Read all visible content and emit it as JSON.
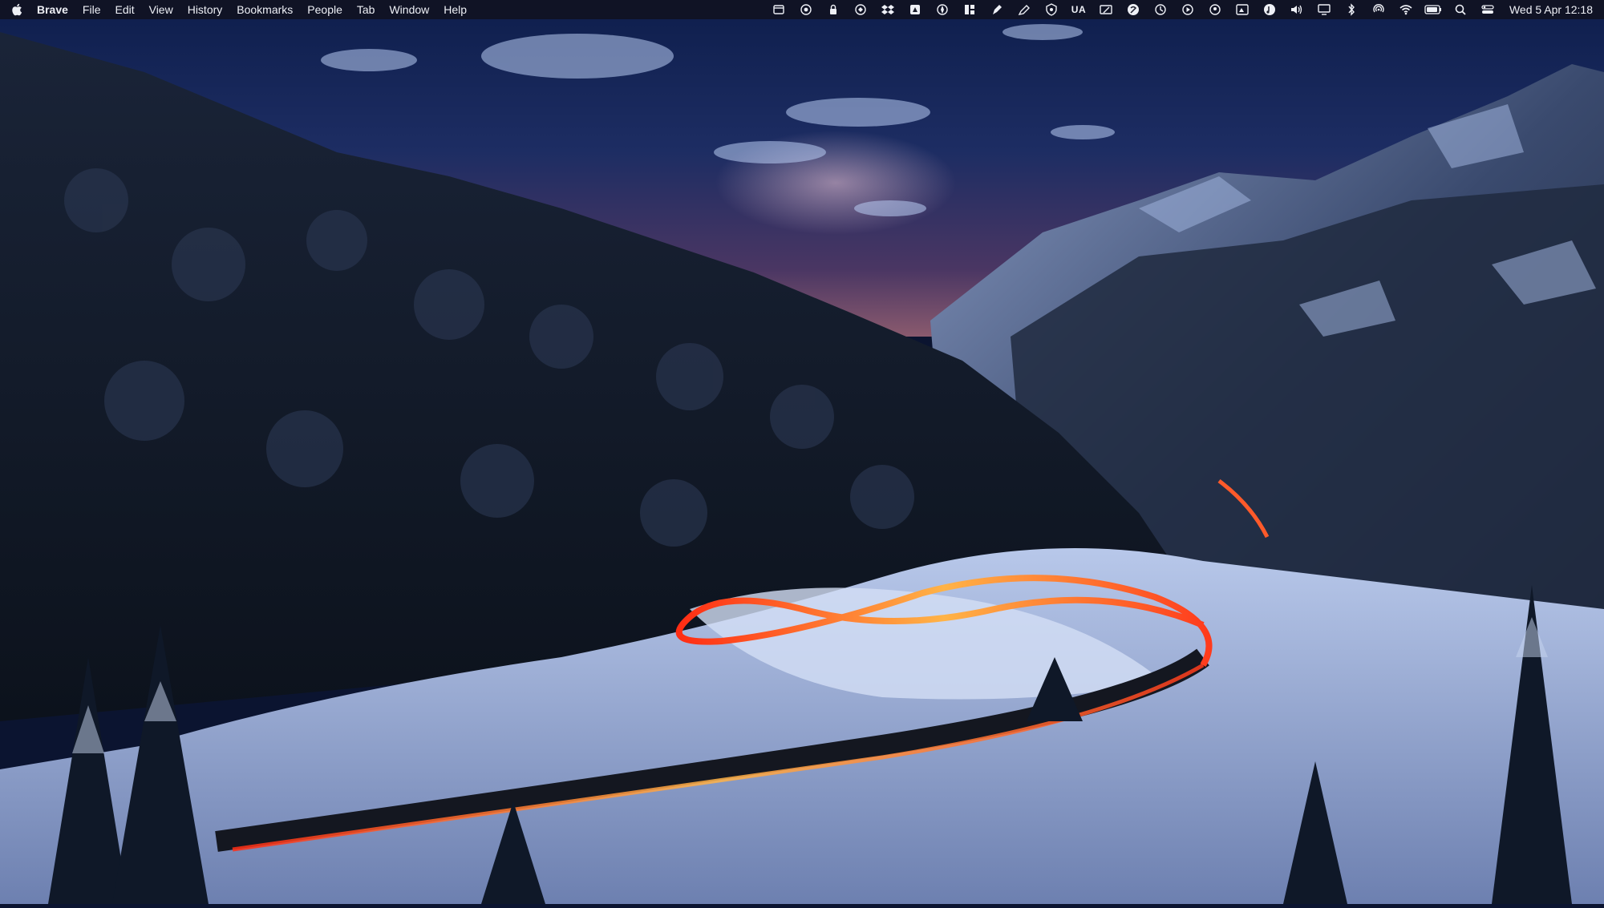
{
  "menubar": {
    "apple_icon": "apple-logo-icon",
    "app_name": "Brave",
    "menus": [
      "File",
      "Edit",
      "View",
      "History",
      "Bookmarks",
      "People",
      "Tab",
      "Window",
      "Help"
    ],
    "status_icons": [
      "calendar-icon",
      "eye-icon",
      "lock-icon",
      "sync-icon",
      "dropbox-icon",
      "drive-icon",
      "compass-icon",
      "grid-icon",
      "pen-nib-icon",
      "marker-icon",
      "shield-icon",
      "UA",
      "note-icon",
      "logo-circle-icon",
      "time-machine-icon",
      "play-icon",
      "user-circle-icon",
      "screen-capture-icon",
      "music-icon",
      "volume-icon",
      "display-icon",
      "bluetooth-icon",
      "airdrop-icon",
      "wifi-icon",
      "battery-icon",
      "spotlight-search-icon",
      "control-center-icon"
    ],
    "clock": "Wed 5 Apr  12:18"
  },
  "desktop": {
    "wallpaper": "night mountain valley with snowy forest and light trails on winding road",
    "colors": {
      "sky_top": "#10204e",
      "sky_glow": "#5a3a66",
      "forest": "#121a26",
      "snow": "#c9d6ee",
      "trail_red": "#ff3a1a",
      "trail_orange": "#ffb040"
    }
  }
}
